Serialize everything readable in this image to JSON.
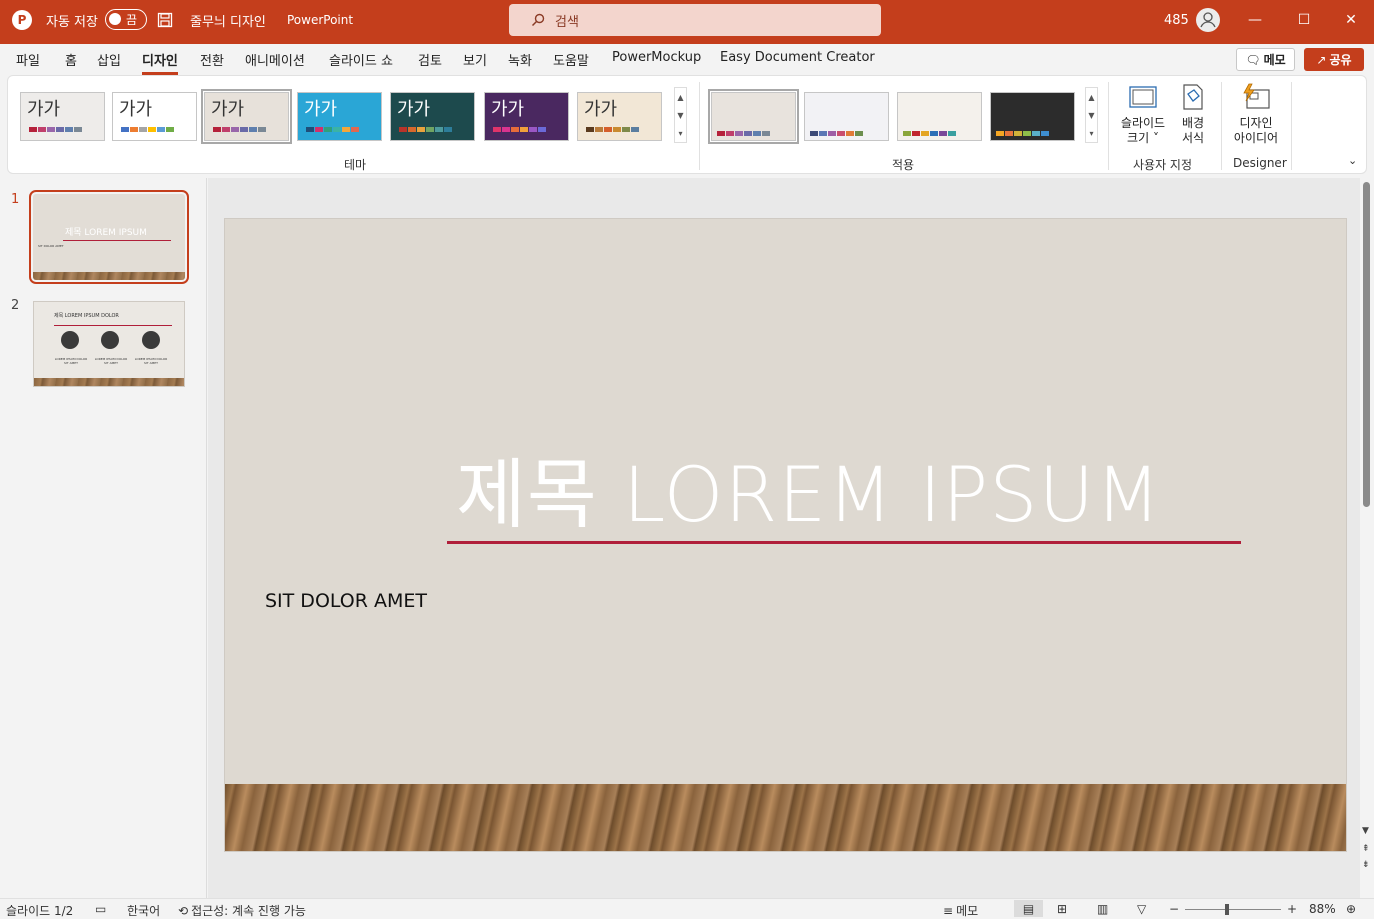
{
  "titlebar": {
    "autosave_label": "자동 저장",
    "autosave_state": "끔",
    "doc_title": "줄무늬 디자인",
    "app_name": "PowerPoint",
    "search_placeholder": "검색",
    "user_number": "485",
    "color": "#c43e1c"
  },
  "tabs": [
    "파일",
    "홈",
    "삽입",
    "디자인",
    "전환",
    "애니메이션",
    "슬라이드 쇼",
    "검토",
    "보기",
    "녹화",
    "도움말",
    "PowerMockup",
    "Easy Document Creator"
  ],
  "active_tab": "디자인",
  "header_buttons": {
    "memo": "메모",
    "share": "공유"
  },
  "ribbon": {
    "themes": [
      {
        "label": "가가",
        "bg": "#eeecea",
        "text": "#333",
        "bars": [
          "#b5213a",
          "#c03f6b",
          "#9966aa",
          "#6a6aa8",
          "#5f7fae",
          "#7a8895"
        ]
      },
      {
        "label": "가가",
        "bg": "#ffffff",
        "text": "#333",
        "bars": [
          "#4472c4",
          "#ed7d31",
          "#a5a5a5",
          "#ffc000",
          "#5b9bd5",
          "#70ad47"
        ]
      },
      {
        "label": "가가",
        "bg": "#e7e1da",
        "text": "#333",
        "bars": [
          "#b5213a",
          "#c03f6b",
          "#9966aa",
          "#6a6aa8",
          "#5f7fae",
          "#7a8895"
        ]
      },
      {
        "label": "가가",
        "bg": "#2aa6d6",
        "text": "#fff",
        "bars": [
          "#1f4e79",
          "#d0306c",
          "#2fa07d",
          "#3bb3a5",
          "#f2a73b",
          "#e0674f"
        ]
      },
      {
        "label": "가가",
        "bg": "#1d4a4d",
        "text": "#fff",
        "bars": [
          "#b8332a",
          "#d7682c",
          "#e8a33d",
          "#6fa463",
          "#4c9a9d",
          "#2d7d9a"
        ]
      },
      {
        "label": "가가",
        "bg": "#4a2860",
        "text": "#fff",
        "bars": [
          "#e0346a",
          "#d9348f",
          "#e66c3a",
          "#f0a03a",
          "#9a57c4",
          "#6b6ad8"
        ]
      },
      {
        "label": "가가",
        "bg": "#f2e7d6",
        "text": "#333",
        "bars": [
          "#5a3a1e",
          "#b97b3a",
          "#d55f2c",
          "#c98a2f",
          "#7f8a4a",
          "#5b7ea0"
        ]
      }
    ],
    "variants": [
      {
        "bg": "#e8e3dd",
        "bars": [
          "#b5213a",
          "#c03f6b",
          "#9966aa",
          "#6a6aa8",
          "#5f7fae",
          "#7a8895"
        ]
      },
      {
        "bg": "#f2f2f5",
        "bars": [
          "#3d4b78",
          "#5b77b5",
          "#9e5fa6",
          "#c94e6f",
          "#e07b39",
          "#6c8e4e"
        ]
      },
      {
        "bg": "#f4f1ec",
        "bars": [
          "#8aa63a",
          "#c1272d",
          "#e4a522",
          "#2c6fb6",
          "#7a4a9a",
          "#3aa0a0"
        ]
      },
      {
        "bg": "#2c2c2c",
        "bars": [
          "#f5a623",
          "#e8743b",
          "#d0b13a",
          "#8fbf4a",
          "#5ab0c9",
          "#3e8ed0"
        ]
      }
    ],
    "group_themes": "테마",
    "group_variants": "적용",
    "slide_size": "슬라이드 크기",
    "slide_size_line1": "슬라이드",
    "slide_size_line2": "크기 ˅",
    "bg_format_line1": "배경",
    "bg_format_line2": "서식",
    "group_customize": "사용자 지정",
    "design_ideas_line1": "디자인",
    "design_ideas_line2": "아이디어",
    "group_designer": "Designer"
  },
  "slides": [
    {
      "number": "1",
      "title": "제목 LOREM IPSUM",
      "subtitle": "SIT DOLOR AMET"
    },
    {
      "number": "2",
      "title": "제목 LOREM IPSUM DOLOR",
      "items": [
        "LOREM IPSUM DOLOR SIT AMET",
        "LOREM IPSUM DOLOR SIT AMET",
        "LOREM IPSUM DOLOR SIT AMET"
      ]
    }
  ],
  "main_slide": {
    "title": "제목 LOREM IPSUM",
    "subtitle": "SIT DOLOR AMET",
    "accent": "#b01f3a"
  },
  "status": {
    "slide_info": "슬라이드 1/2",
    "language": "한국어",
    "accessibility": "접근성: 계속 진행 가능",
    "notes": "메모",
    "zoom": "88%",
    "zoom_fraction": 0.42
  }
}
